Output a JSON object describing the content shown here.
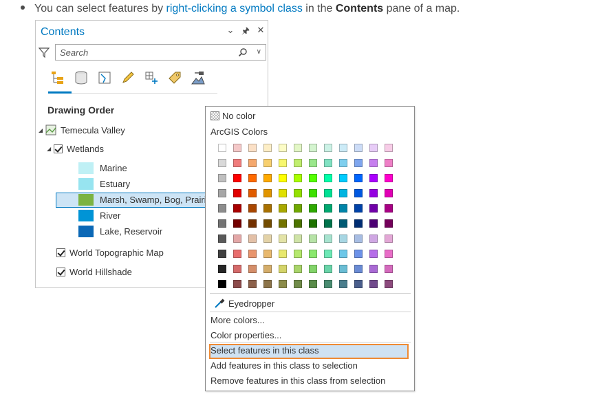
{
  "intro": {
    "before": "You can select features by ",
    "link": "right-clicking a symbol class",
    "middle": " in the ",
    "bold": "Contents",
    "after": " pane of a map."
  },
  "pane": {
    "title": "Contents",
    "search_placeholder": "Search",
    "section_title": "Drawing Order",
    "map_name": "Temecula Valley",
    "layer_name": "Wetlands",
    "classes": [
      {
        "label": "Marine",
        "color": "#bff0f5"
      },
      {
        "label": "Estuary",
        "color": "#97e4f0"
      },
      {
        "label": "Marsh, Swamp, Bog, Prairie",
        "color": "#7cb342"
      },
      {
        "label": "River",
        "color": "#0094d6"
      },
      {
        "label": "Lake, Reservoir",
        "color": "#0b68b6"
      }
    ],
    "basemaps": [
      "World Topographic Map",
      "World Hillshade"
    ]
  },
  "menu": {
    "no_color": "No color",
    "palette_title": "ArcGIS Colors",
    "eyedropper": "Eyedropper",
    "more_colors": "More colors...",
    "color_properties": "Color properties...",
    "select_features": "Select features in this class",
    "add_features": "Add features in this class to selection",
    "remove_features": "Remove features in this class from selection"
  },
  "palette": [
    [
      "#ffffff",
      "#f4c8c8",
      "#fbe0c6",
      "#fdeec6",
      "#fcfcc6",
      "#e3f7c6",
      "#d4f4cf",
      "#ccf2e6",
      "#ccebf7",
      "#ccdcf7",
      "#e7ccf7",
      "#f7cce7"
    ],
    [
      "#d9d9d9",
      "#ef7c7c",
      "#f4a86e",
      "#f7cf6e",
      "#f7f76e",
      "#c1ee6e",
      "#9ae78c",
      "#82e2c3",
      "#7fcfee",
      "#7fa6ee",
      "#c67fee",
      "#ee7fc6"
    ],
    [
      "#bfbfbf",
      "#ff0000",
      "#ff6a00",
      "#ffaa00",
      "#ffff00",
      "#aaff00",
      "#55ff00",
      "#00ffaa",
      "#00ccff",
      "#0066ff",
      "#aa00ff",
      "#ff00cc"
    ],
    [
      "#a6a6a6",
      "#e00000",
      "#e05c00",
      "#e09400",
      "#e0e000",
      "#94e000",
      "#3ee000",
      "#00e094",
      "#00b4e0",
      "#0058e0",
      "#9400e0",
      "#e000b4"
    ],
    [
      "#8c8c8c",
      "#a80000",
      "#a84600",
      "#a87000",
      "#a8a800",
      "#70a800",
      "#2ea800",
      "#00a870",
      "#0084a8",
      "#0042a8",
      "#7000a8",
      "#a80084"
    ],
    [
      "#737373",
      "#730000",
      "#733000",
      "#734c00",
      "#737300",
      "#4c7300",
      "#1f7300",
      "#00734c",
      "#005a73",
      "#002d73",
      "#4c0073",
      "#73005a"
    ],
    [
      "#595959",
      "#e3a7a7",
      "#e3c0a7",
      "#e3d2a7",
      "#e3e3a7",
      "#cfe3a7",
      "#b7e3a7",
      "#a7e3cf",
      "#a7d6e3",
      "#a7bde3",
      "#cfa7e3",
      "#e3a7d6"
    ],
    [
      "#404040",
      "#e86d6d",
      "#e8956d",
      "#e8b86d",
      "#e8e86d",
      "#b5e86d",
      "#8ae86d",
      "#6de8b5",
      "#6dc7e8",
      "#6d92e8",
      "#b56de8",
      "#e86dc7"
    ],
    [
      "#262626",
      "#d46a6a",
      "#d48e6a",
      "#d4ad6a",
      "#d4d46a",
      "#a9d46a",
      "#83d46a",
      "#6ad4a9",
      "#6abdd4",
      "#6a8bd4",
      "#a96ad4",
      "#d46abd"
    ],
    [
      "#000000",
      "#8c4a4a",
      "#8c614a",
      "#8c744a",
      "#8c8c4a",
      "#718c4a",
      "#5a8c4a",
      "#4a8c71",
      "#4a7d8c",
      "#4a5e8c",
      "#714a8c",
      "#8c4a7d"
    ]
  ]
}
